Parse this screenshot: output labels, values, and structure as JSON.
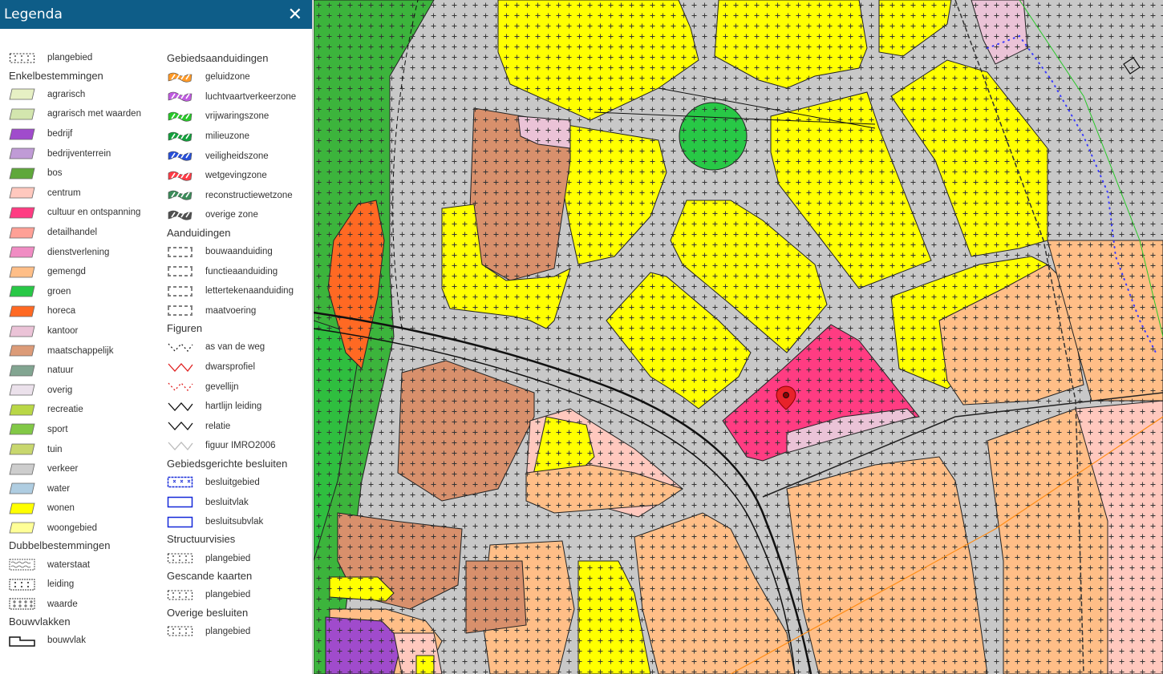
{
  "legend": {
    "title": "Legenda",
    "close": "✕",
    "col1": {
      "plangebied": "plangebied",
      "enkel_title": "Enkelbestemmingen",
      "enkel": [
        {
          "label": "agrarisch",
          "color": "#e6f0c4"
        },
        {
          "label": "agrarisch met waarden",
          "color": "#d3e6ae"
        },
        {
          "label": "bedrijf",
          "color": "#a04bcc"
        },
        {
          "label": "bedrijventerrein",
          "color": "#c09bd6"
        },
        {
          "label": "bos",
          "color": "#5fa83a"
        },
        {
          "label": "centrum",
          "color": "#ffc8be"
        },
        {
          "label": "cultuur en ontspanning",
          "color": "#ff3c82"
        },
        {
          "label": "detailhandel",
          "color": "#ffa096"
        },
        {
          "label": "dienstverlening",
          "color": "#f08cc3"
        },
        {
          "label": "gemengd",
          "color": "#ffbe87"
        },
        {
          "label": "groen",
          "color": "#28c846"
        },
        {
          "label": "horeca",
          "color": "#ff6923"
        },
        {
          "label": "kantoor",
          "color": "#ebc3d7"
        },
        {
          "label": "maatschappelijk",
          "color": "#dc9b78"
        },
        {
          "label": "natuur",
          "color": "#82a591"
        },
        {
          "label": "overig",
          "color": "#ebe1eb"
        },
        {
          "label": "recreatie",
          "color": "#b9d746"
        },
        {
          "label": "sport",
          "color": "#82c846"
        },
        {
          "label": "tuin",
          "color": "#c8d76e"
        },
        {
          "label": "verkeer",
          "color": "#cdcdcd"
        },
        {
          "label": "water",
          "color": "#afcde1"
        },
        {
          "label": "wonen",
          "color": "#ffff00"
        },
        {
          "label": "woongebied",
          "color": "#ffff97"
        }
      ],
      "dubbel_title": "Dubbelbestemmingen",
      "dubbel": [
        "waterstaat",
        "leiding",
        "waarde"
      ],
      "bouw_title": "Bouwvlakken",
      "bouwvlak": "bouwvlak"
    },
    "col2": {
      "gebied_title": "Gebiedsaanduidingen",
      "gebied": [
        {
          "label": "geluidzone",
          "color": "#ff9a28"
        },
        {
          "label": "luchtvaartverkeerzone",
          "color": "#c05ae0"
        },
        {
          "label": "vrijwaringszone",
          "color": "#28c828"
        },
        {
          "label": "milieuzone",
          "color": "#14a03c"
        },
        {
          "label": "veiligheidszone",
          "color": "#2850d8"
        },
        {
          "label": "wetgevingzone",
          "color": "#ff3c46"
        },
        {
          "label": "reconstructiewetzone",
          "color": "#3c8c5a"
        },
        {
          "label": "overige zone",
          "color": "#505050"
        }
      ],
      "aand_title": "Aanduidingen",
      "aand": [
        "bouwaanduiding",
        "functieaanduiding",
        "lettertekenaanduiding",
        "maatvoering"
      ],
      "fig_title": "Figuren",
      "fig": [
        {
          "label": "as van de weg",
          "color": "#222",
          "dash": "2,3"
        },
        {
          "label": "dwarsprofiel",
          "color": "#e02020",
          "dash": ""
        },
        {
          "label": "gevellijn",
          "color": "#e02020",
          "dash": "2,3"
        },
        {
          "label": "hartlijn leiding",
          "color": "#111",
          "dash": ""
        },
        {
          "label": "relatie",
          "color": "#111",
          "dash": ""
        },
        {
          "label": "figuur IMRO2006",
          "color": "#bbb",
          "dash": ""
        }
      ],
      "besl_title": "Gebiedsgerichte besluiten",
      "besl": [
        "besluitgebied",
        "besluitvlak",
        "besluitsubvlak"
      ],
      "struct_title": "Structuurvisies",
      "struct": "plangebied",
      "scan_title": "Gescande kaarten",
      "scan": "plangebied",
      "overige_title": "Overige besluiten",
      "overige": "plangebied"
    }
  },
  "map": {
    "colors": {
      "verkeer": "#c8c8c8",
      "wonen": "#ffff00",
      "gemengd": "#ffbe87",
      "maatschappelijk": "#d8906c",
      "cultuur": "#ff3c82",
      "kantoor": "#ebc3d7",
      "groen": "#28c846",
      "bos": "#3cb43c",
      "horeca": "#ff6923",
      "bedrijf": "#a04bcc",
      "centrum": "#ffc8be",
      "marker": "#e8222a"
    }
  }
}
